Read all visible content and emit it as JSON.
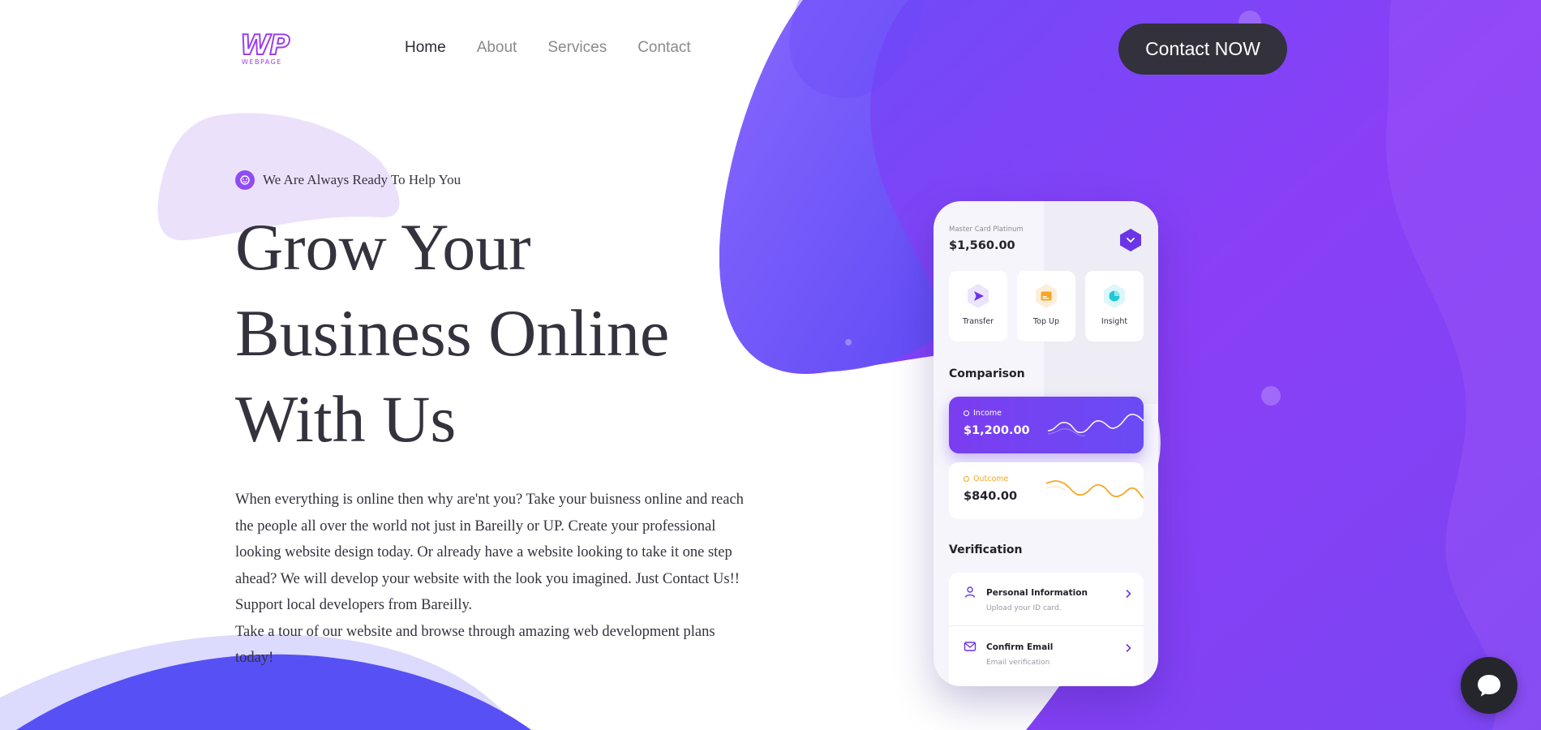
{
  "logo": {
    "main": "WP",
    "sub": "WEBPAGE"
  },
  "nav": {
    "items": [
      "Home",
      "About",
      "Services",
      "Contact"
    ],
    "active": "Home"
  },
  "header": {
    "cta_label": "Contact NOW"
  },
  "hero": {
    "tagline": "We Are Always Ready To Help You",
    "title_lines": [
      "Grow Your",
      "Business Online",
      "With Us"
    ],
    "paragraph": "When everything is online then why are'nt you? Take your buisness online and reach the people all over the world not just in Bareilly or UP. Create your professional looking website design today. Or already have a website looking to take it one step ahead? We will develop your website with the look you imagined. Just Contact Us!! Support local developers from Bareilly.",
    "paragraph2": "Take a tour of our website and browse through amazing web development plans today!"
  },
  "phone": {
    "card_name": "Master Card Platinum",
    "card_amount": "$1,560.00",
    "actions": [
      {
        "label": "Transfer",
        "icon": "send-icon"
      },
      {
        "label": "Top Up",
        "icon": "card-icon"
      },
      {
        "label": "Insight",
        "icon": "pie-chart-icon"
      }
    ],
    "comparison_title": "Comparison",
    "income": {
      "label": "Income",
      "value": "$1,200.00"
    },
    "outcome": {
      "label": "Outcome",
      "value": "$840.00"
    },
    "verification_title": "Verification",
    "verification": [
      {
        "title": "Personal Information",
        "subtitle": "Upload your ID card.",
        "icon": "user-icon"
      },
      {
        "title": "Confirm Email",
        "subtitle": "Email verification",
        "icon": "mail-icon"
      }
    ]
  },
  "colors": {
    "brand_purple": "#8f4cf2",
    "dark": "#33313c",
    "blob_purple": "#7a3ff5",
    "blob_blue": "#5b52f5",
    "outcome_orange": "#f5a623"
  },
  "chat": {
    "icon": "chat-bubble-icon"
  }
}
